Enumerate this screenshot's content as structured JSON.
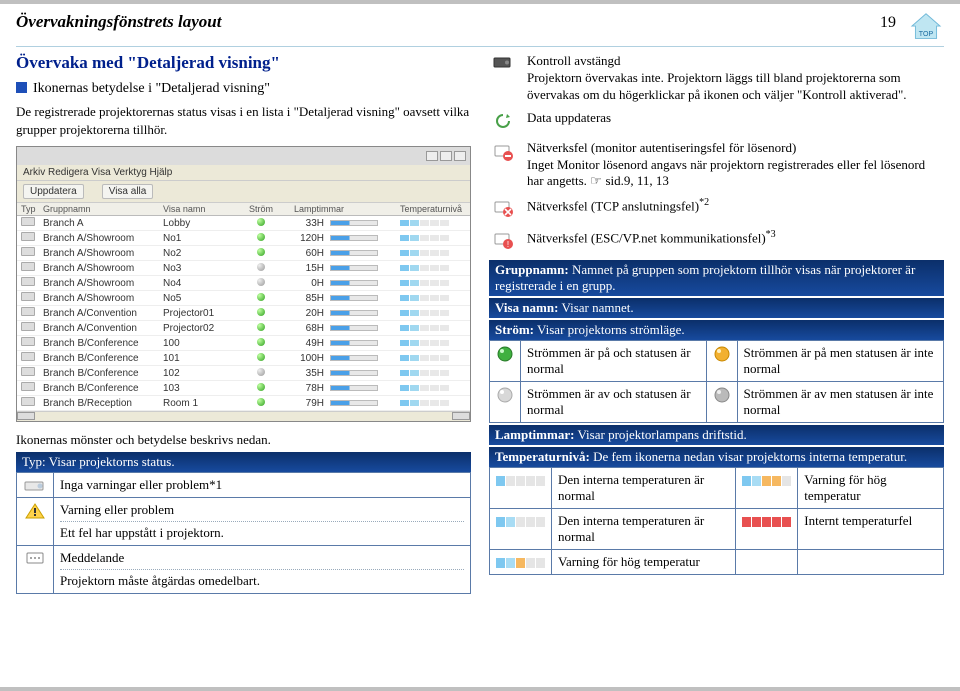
{
  "header": {
    "title": "Övervakningsfönstrets layout",
    "page_number": "19",
    "top_icon_label": "TOP"
  },
  "left": {
    "h2": "Övervaka med \"Detaljerad visning\"",
    "h3": "Ikonernas betydelse i \"Detaljerad visning\"",
    "intro": "De registrerade projektorernas status visas i en lista i \"Detaljerad visning\" oavsett vilka grupper projektorerna tillhör.",
    "app": {
      "menu": "Arkiv  Redigera  Visa  Verktyg  Hjälp",
      "btn_update": "Uppdatera",
      "btn_showall": "Visa alla",
      "cols": {
        "type": "Typ",
        "group": "Gruppnamn",
        "vis": "Visa namn",
        "pwr": "Ström",
        "hrs": "Lamptimmar",
        "temp": "Temperaturnivå"
      },
      "rows": [
        {
          "g": "Branch A",
          "v": "Lobby",
          "on": true,
          "h": "33H"
        },
        {
          "g": "Branch A/Showroom",
          "v": "No1",
          "on": true,
          "h": "120H"
        },
        {
          "g": "Branch A/Showroom",
          "v": "No2",
          "on": true,
          "h": "60H"
        },
        {
          "g": "Branch A/Showroom",
          "v": "No3",
          "on": false,
          "h": "15H"
        },
        {
          "g": "Branch A/Showroom",
          "v": "No4",
          "on": false,
          "h": "0H"
        },
        {
          "g": "Branch A/Showroom",
          "v": "No5",
          "on": true,
          "h": "85H"
        },
        {
          "g": "Branch A/Convention",
          "v": "Projector01",
          "on": true,
          "h": "20H"
        },
        {
          "g": "Branch A/Convention",
          "v": "Projector02",
          "on": true,
          "h": "68H"
        },
        {
          "g": "Branch B/Conference",
          "v": "100",
          "on": true,
          "h": "49H"
        },
        {
          "g": "Branch B/Conference",
          "v": "101",
          "on": true,
          "h": "100H"
        },
        {
          "g": "Branch B/Conference",
          "v": "102",
          "on": false,
          "h": "35H"
        },
        {
          "g": "Branch B/Conference",
          "v": "103",
          "on": true,
          "h": "78H"
        },
        {
          "g": "Branch B/Reception",
          "v": "Room 1",
          "on": true,
          "h": "79H"
        }
      ]
    },
    "caption": "Ikonernas mönster och betydelse beskrivs nedan.",
    "type_strip": "Typ: Visar projektorns status.",
    "type_table": {
      "row1": "Inga varningar eller problem*1",
      "row2_t": "Varning eller problem",
      "row2_d": "Ett fel har uppstått i projektorn.",
      "row3_t": "Meddelande",
      "row3_d": "Projektorn måste åtgärdas omedelbart."
    }
  },
  "right": {
    "items": [
      {
        "title": "Kontroll avstängd",
        "desc": "Projektorn övervakas inte. Projektorn läggs till bland projektorerna som övervakas om du högerklickar på ikonen och väljer \"Kontroll aktiverad\"."
      },
      {
        "title": "Data uppdateras",
        "desc": ""
      },
      {
        "title": "Nätverksfel (monitor autentiseringsfel för lösenord)",
        "desc": "Inget Monitor lösenord angavs när projektorn registrerades eller fel lösenord har angetts. ",
        "link": "sid.9, 11, 13"
      },
      {
        "title": "Nätverksfel (TCP anslutningsfel)",
        "sup": "*2",
        "desc": ""
      },
      {
        "title": "Nätverksfel (ESC/VP.net kommunikationsfel)",
        "sup": "*3",
        "desc": ""
      }
    ],
    "strip_group_label": "Gruppnamn:",
    "strip_group_text": " Namnet på gruppen som projektorn tillhör visas när projektorer är registrerade i en grupp.",
    "strip_name_label": "Visa namn:",
    "strip_name_text": " Visar namnet.",
    "strip_power_label": "Ström:",
    "strip_power_text": " Visar projektorns strömläge.",
    "power_table": {
      "r1c1": "Strömmen är på och statusen är normal",
      "r1c2": "Strömmen är på men statusen är inte normal",
      "r2c1": "Strömmen är av och statusen är normal",
      "r2c2": "Strömmen är av men statusen är inte normal"
    },
    "strip_lamp_label": "Lamptimmar:",
    "strip_lamp_text": " Visar projektorlampans driftstid.",
    "strip_temp_label": "Temperaturnivå:",
    "strip_temp_text": " De fem ikonerna nedan visar projektorns interna temperatur.",
    "temp_table": {
      "r1c1": "Den interna temperaturen är normal",
      "r1c2": "Varning för hög temperatur",
      "r2c1": "Den interna temperaturen är normal",
      "r2c2": "Internt temperaturfel",
      "r3c1": "Varning för hög temperatur"
    }
  }
}
